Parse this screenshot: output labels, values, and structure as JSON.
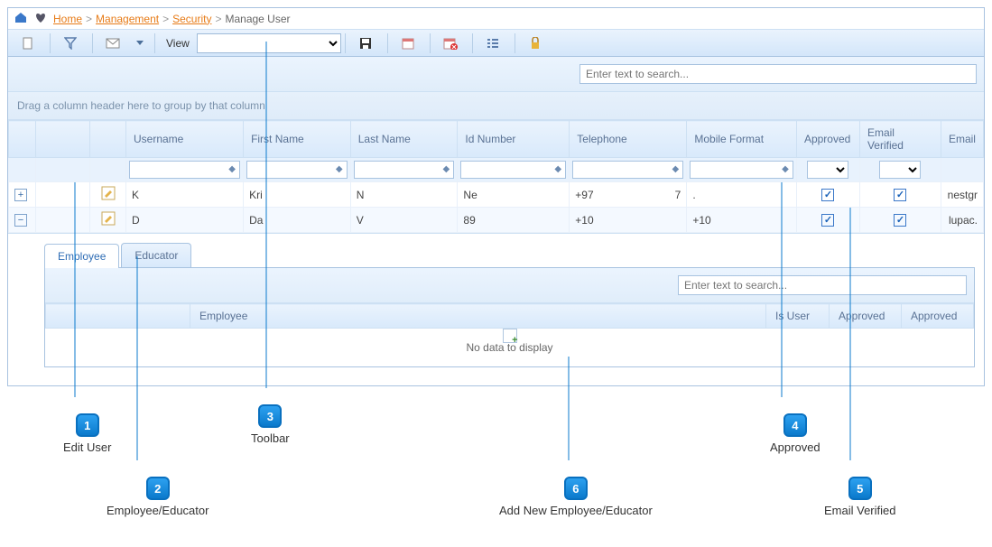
{
  "breadcrumb": {
    "home": "Home",
    "management": "Management",
    "security": "Security",
    "current": "Manage User"
  },
  "toolbar": {
    "view_label": "View"
  },
  "search": {
    "placeholder": "Enter text to search..."
  },
  "group_zone": "Drag a column header here to group by that column",
  "columns": {
    "username": "Username",
    "firstname": "First Name",
    "lastname": "Last Name",
    "idnumber": "Id Number",
    "telephone": "Telephone",
    "mobileformat": "Mobile Format",
    "approved": "Approved",
    "emailverified": "Email Verified",
    "email": "Email"
  },
  "rows": [
    {
      "username": "K",
      "firstname": "Kri",
      "lastname": "N",
      "idnumber": "Ne",
      "telephone": "+97",
      "telnote": "7",
      "mobileformat": ".",
      "approved": true,
      "emailverified": true,
      "email": "nestgr"
    },
    {
      "username": "D",
      "firstname": "Da",
      "lastname": "V",
      "idnumber": "89",
      "telephone": "+10",
      "telnote": "",
      "mobileformat": "+10",
      "approved": true,
      "emailverified": true,
      "email": "lupac."
    }
  ],
  "tabs": {
    "employee": "Employee",
    "educator": "Educator"
  },
  "subgrid": {
    "search_placeholder": "Enter text to search...",
    "cols": {
      "employee": "Employee",
      "isuser": "Is User",
      "approved": "Approved",
      "approved2": "Approved"
    },
    "no_data": "No data to display"
  },
  "callouts": {
    "c1": "Edit User",
    "c2": "Employee/Educator",
    "c3": "Toolbar",
    "c4": "Approved",
    "c5": "Email Verified",
    "c6": "Add New Employee/Educator"
  }
}
